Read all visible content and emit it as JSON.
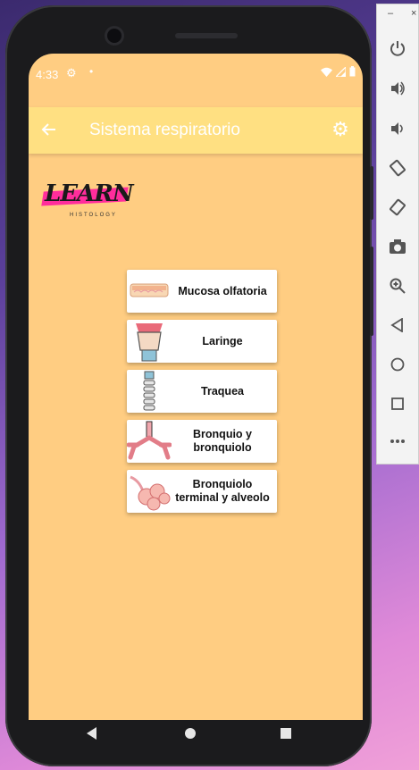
{
  "status_bar": {
    "time": "4:33",
    "icons": [
      "settings-icon",
      "notification-dot",
      "wifi-icon",
      "signal-icon",
      "battery-icon"
    ]
  },
  "app_bar": {
    "title": "Sistema respiratorio",
    "back_icon": "arrow-left-icon",
    "settings_icon": "gear-icon"
  },
  "logo": {
    "word": "LEARN",
    "subtitle": "HISTOLOGY"
  },
  "menu": {
    "items": [
      {
        "label": "Mucosa olfatoria",
        "icon": "olfactory-mucosa-icon"
      },
      {
        "label": "Laringe",
        "icon": "larynx-icon"
      },
      {
        "label": "Traquea",
        "icon": "trachea-icon"
      },
      {
        "label": "Bronquio y bronquiolo",
        "icon": "bronchus-icon"
      },
      {
        "label": "Bronquiolo terminal y alveolo",
        "icon": "alveolus-icon"
      }
    ]
  },
  "emulator_toolbar": {
    "window_controls": [
      "minimize-icon",
      "close-icon"
    ],
    "buttons": [
      "power-icon",
      "volume-up-icon",
      "volume-down-icon",
      "rotate-left-icon",
      "rotate-right-icon",
      "camera-icon",
      "zoom-icon",
      "back-icon",
      "home-icon",
      "overview-icon",
      "more-icon"
    ]
  },
  "colors": {
    "screen_bg": "#ffcd82",
    "app_bar_bg": "#ffe082",
    "logo_accent": "#ff2d9c"
  }
}
